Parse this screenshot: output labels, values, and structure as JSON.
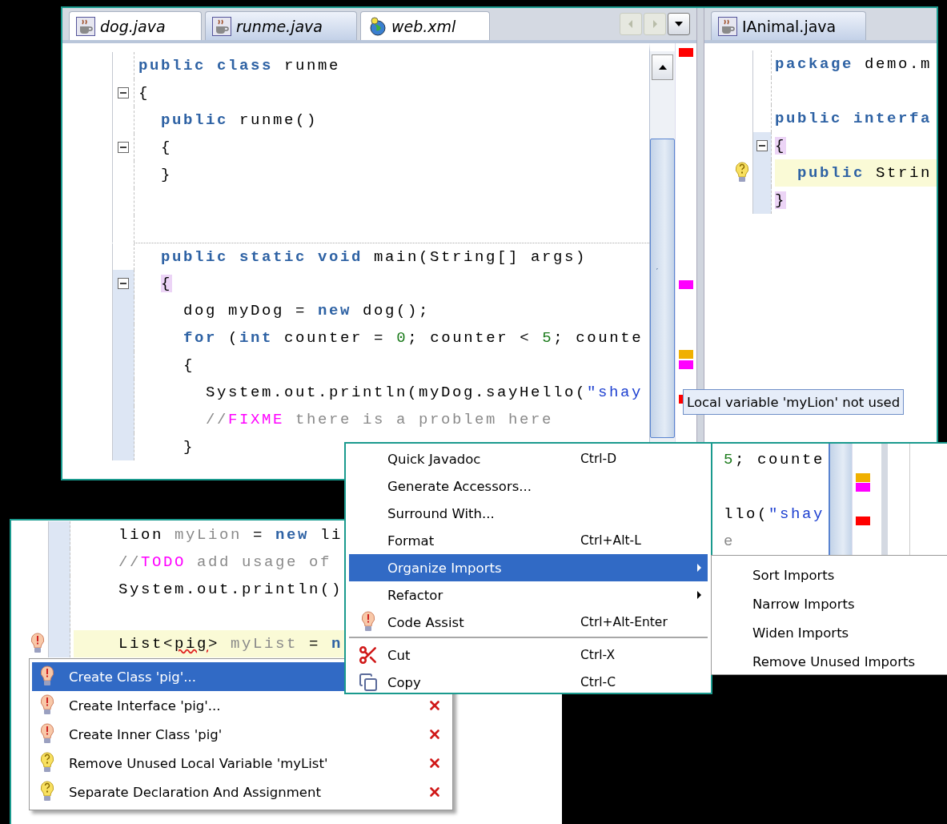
{
  "main_editor": {
    "tabs": [
      {
        "kind": "java",
        "label": "dog.java",
        "selected": false,
        "modified": true
      },
      {
        "kind": "java",
        "label": "runme.java",
        "selected": true,
        "modified": true
      },
      {
        "kind": "xml",
        "label": "web.xml",
        "selected": false,
        "modified": true
      }
    ],
    "tab_controls": [
      {
        "kind": "back",
        "disabled": true
      },
      {
        "kind": "forward",
        "disabled": true
      },
      {
        "kind": "list",
        "disabled": false
      }
    ],
    "lines": [
      {
        "kind": "code",
        "tokens": [
          {
            "kind": "keyword",
            "text": "public class"
          },
          {
            "kind": "plain",
            "text": " runme"
          }
        ]
      },
      {
        "kind": "code",
        "fold": true,
        "tokens": [
          {
            "kind": "plain",
            "text": "{"
          }
        ]
      },
      {
        "kind": "code",
        "tokens": [
          {
            "kind": "keyword",
            "text": "  public"
          },
          {
            "kind": "plain",
            "text": " runme()"
          }
        ]
      },
      {
        "kind": "code",
        "fold": true,
        "tokens": [
          {
            "kind": "plain",
            "text": "  {"
          }
        ]
      },
      {
        "kind": "code",
        "tokens": [
          {
            "kind": "plain",
            "text": "  }"
          }
        ]
      },
      {
        "kind": "blank"
      },
      {
        "kind": "blank"
      },
      {
        "kind": "code",
        "separator_above": true,
        "tokens": [
          {
            "kind": "keyword",
            "text": "  public static void"
          },
          {
            "kind": "plain",
            "text": " main(String[] args)"
          }
        ]
      },
      {
        "kind": "code",
        "fold": true,
        "scope": true,
        "tokens": [
          {
            "kind": "brace",
            "text": "  {"
          }
        ]
      },
      {
        "kind": "code",
        "scope": true,
        "tokens": [
          {
            "kind": "plain",
            "text": "    dog myDog = "
          },
          {
            "kind": "keyword",
            "text": "new"
          },
          {
            "kind": "plain",
            "text": " dog();"
          }
        ]
      },
      {
        "kind": "code",
        "scope": true,
        "tokens": [
          {
            "kind": "keyword",
            "text": "    for"
          },
          {
            "kind": "plain",
            "text": " ("
          },
          {
            "kind": "keyword",
            "text": "int"
          },
          {
            "kind": "plain",
            "text": " counter = "
          },
          {
            "kind": "number",
            "text": "0"
          },
          {
            "kind": "plain",
            "text": "; counter < "
          },
          {
            "kind": "number",
            "text": "5"
          },
          {
            "kind": "plain",
            "text": "; counte"
          }
        ]
      },
      {
        "kind": "code",
        "scope": true,
        "tokens": [
          {
            "kind": "plain",
            "text": "    {"
          }
        ]
      },
      {
        "kind": "code",
        "scope": true,
        "tokens": [
          {
            "kind": "plain",
            "text": "      System.out.println(myDog.sayHello("
          },
          {
            "kind": "string",
            "text": "\"shay"
          }
        ]
      },
      {
        "kind": "code",
        "scope": true,
        "tokens": [
          {
            "kind": "comment",
            "text": "      //"
          },
          {
            "kind": "todo",
            "text": "FIXME"
          },
          {
            "kind": "comment",
            "text": " there is a problem here"
          }
        ]
      },
      {
        "kind": "code",
        "scope": true,
        "tokens": [
          {
            "kind": "plain",
            "text": "    }"
          }
        ]
      }
    ],
    "error_stripe": [
      {
        "color": "#ff0000"
      },
      {
        "color": "#ff00ff"
      },
      {
        "color": "#f0b000"
      },
      {
        "color": "#ff00ff"
      },
      {
        "color": "#ff0000"
      }
    ]
  },
  "side_editor": {
    "tabs": [
      {
        "kind": "java",
        "label": "IAnimal.java",
        "selected": true,
        "modified": false
      }
    ],
    "lines": [
      {
        "kind": "code",
        "tokens": [
          {
            "kind": "keyword",
            "text": "package"
          },
          {
            "kind": "plain",
            "text": " demo.m"
          }
        ]
      },
      {
        "kind": "blank"
      },
      {
        "kind": "code",
        "tokens": [
          {
            "kind": "keyword",
            "text": "public interfa"
          }
        ]
      },
      {
        "kind": "code",
        "fold": true,
        "scope": true,
        "tokens": [
          {
            "kind": "brace",
            "text": "{"
          }
        ]
      },
      {
        "kind": "code",
        "warning_bulb": true,
        "scope": true,
        "current": true,
        "tokens": [
          {
            "kind": "keyword",
            "text": "  public"
          },
          {
            "kind": "plain",
            "text": " Strin"
          }
        ]
      },
      {
        "kind": "code",
        "scope": true,
        "tokens": [
          {
            "kind": "brace",
            "text": "}"
          }
        ]
      }
    ]
  },
  "tooltip": "Local variable 'myLion' not used",
  "background_editor": {
    "lines": [
      {
        "kind": "code",
        "tokens": [
          {
            "kind": "number",
            "text": "5"
          },
          {
            "kind": "plain",
            "text": "; counte"
          }
        ]
      },
      {
        "kind": "blank"
      },
      {
        "kind": "code",
        "tokens": [
          {
            "kind": "plain",
            "text": "llo("
          },
          {
            "kind": "string",
            "text": "\"shay"
          }
        ]
      },
      {
        "kind": "code",
        "tokens": [
          {
            "kind": "unused",
            "text": "e"
          }
        ]
      }
    ],
    "error_stripe": [
      {
        "color": "#f0b000"
      },
      {
        "color": "#ff00ff"
      },
      {
        "color": "#ff0000"
      }
    ]
  },
  "lower_editor": {
    "lines": [
      {
        "kind": "code",
        "scope": true,
        "tokens": [
          {
            "kind": "plain",
            "text": "    lion "
          },
          {
            "kind": "unused",
            "text": "myLion"
          },
          {
            "kind": "plain",
            "text": " = "
          },
          {
            "kind": "keyword",
            "text": "new"
          },
          {
            "kind": "plain",
            "text": " li"
          }
        ]
      },
      {
        "kind": "code",
        "scope": true,
        "tokens": [
          {
            "kind": "comment",
            "text": "    //"
          },
          {
            "kind": "todo",
            "text": "TODO"
          },
          {
            "kind": "comment",
            "text": " add usage of"
          }
        ]
      },
      {
        "kind": "code",
        "scope": true,
        "tokens": [
          {
            "kind": "plain",
            "text": "    System.out.println()"
          }
        ]
      },
      {
        "kind": "blank",
        "scope": true
      },
      {
        "kind": "code",
        "error_bulb": true,
        "scope": true,
        "current": true,
        "tokens": [
          {
            "kind": "plain",
            "text": "    List<"
          },
          {
            "kind": "error",
            "text": "pig"
          },
          {
            "kind": "plain",
            "text": "> "
          },
          {
            "kind": "unused",
            "text": "myList"
          },
          {
            "kind": "plain",
            "text": " = "
          },
          {
            "kind": "keyword",
            "text": "n"
          }
        ]
      }
    ]
  },
  "quick_fix": {
    "items": [
      {
        "kind": "error",
        "label": "Create Class 'pig'...",
        "selected": true
      },
      {
        "kind": "error",
        "label": "Create Interface 'pig'...",
        "selected": false,
        "dismiss": true
      },
      {
        "kind": "error",
        "label": "Create Inner Class 'pig'",
        "selected": false,
        "dismiss": true
      },
      {
        "kind": "hint",
        "label": "Remove Unused Local Variable 'myList'",
        "selected": false,
        "dismiss": true
      },
      {
        "kind": "hint",
        "label": "Separate Declaration And Assignment",
        "selected": false,
        "dismiss": true
      }
    ]
  },
  "context_menu": {
    "items": [
      {
        "kind": "item",
        "label": "Quick Javadoc",
        "shortcut": "Ctrl-D",
        "selected": false,
        "submenu": false
      },
      {
        "kind": "item",
        "label": "Generate Accessors...",
        "selected": false,
        "submenu": false
      },
      {
        "kind": "item",
        "label": "Surround With...",
        "selected": false,
        "submenu": false
      },
      {
        "kind": "item",
        "label": "Format",
        "shortcut": "Ctrl+Alt-L",
        "selected": false,
        "submenu": false
      },
      {
        "kind": "item",
        "label": "Organize Imports",
        "selected": true,
        "submenu": true
      },
      {
        "kind": "item",
        "label": "Refactor",
        "selected": false,
        "submenu": true
      },
      {
        "kind": "assist",
        "label": "Code Assist",
        "shortcut": "Ctrl+Alt-Enter",
        "selected": false,
        "submenu": false
      },
      {
        "kind": "separator"
      },
      {
        "kind": "cut",
        "label": "Cut",
        "shortcut": "Ctrl-X",
        "selected": false,
        "submenu": false
      },
      {
        "kind": "copy",
        "label": "Copy",
        "shortcut": "Ctrl-C",
        "selected": false,
        "submenu": false
      }
    ]
  },
  "submenu": {
    "items": [
      {
        "label": "Sort Imports"
      },
      {
        "label": "Narrow Imports"
      },
      {
        "label": "Widen Imports"
      },
      {
        "label": "Remove Unused Imports"
      }
    ]
  }
}
